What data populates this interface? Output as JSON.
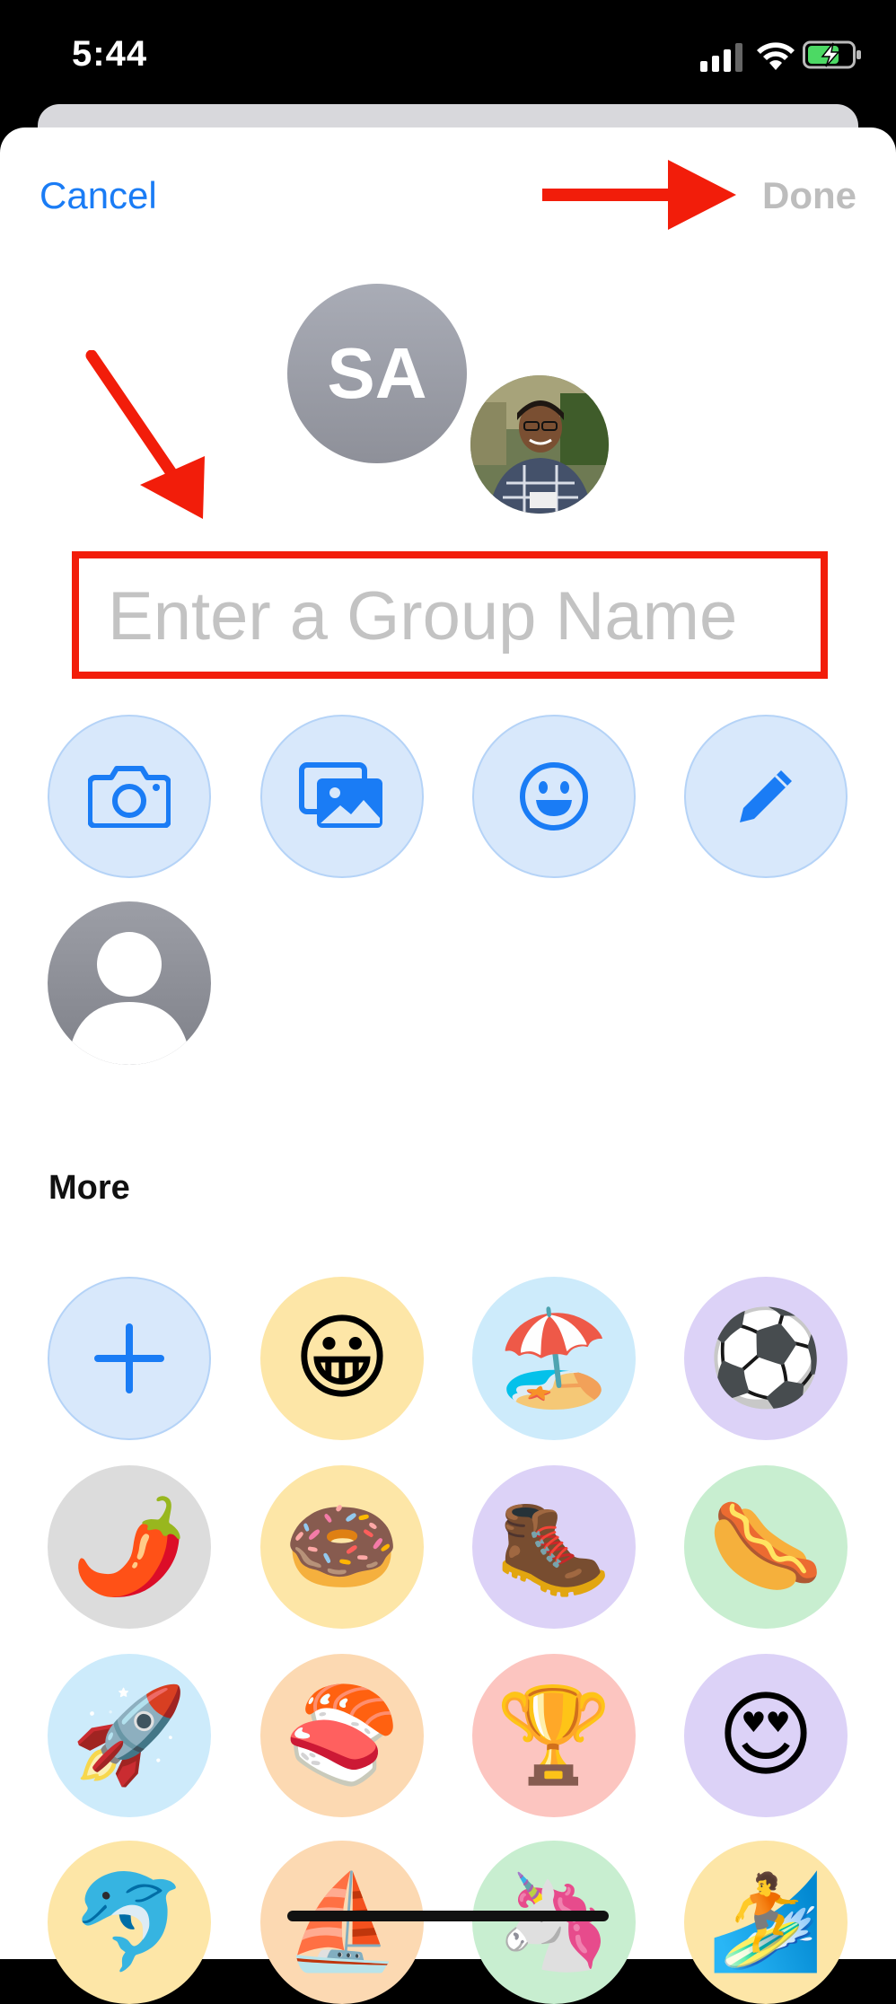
{
  "status_bar": {
    "time": "5:44"
  },
  "header": {
    "cancel_label": "Cancel",
    "done_label": "Done"
  },
  "group": {
    "avatar_initials": "SA",
    "name_placeholder": "Enter a Group Name"
  },
  "photo_options": [
    "camera-icon",
    "photos-icon",
    "emoji-icon",
    "pencil-icon"
  ],
  "more": {
    "title": "More",
    "items": [
      {
        "icon": "add-icon"
      },
      {
        "emoji": "😀",
        "bg": "#fde6a7"
      },
      {
        "emoji": "🏖️",
        "bg": "#cdebfb"
      },
      {
        "emoji": "⚽",
        "bg": "#dcd2f7"
      },
      {
        "emoji": "🌶️",
        "bg": "#dcdcdc"
      },
      {
        "emoji": "🍩",
        "bg": "#fde6a7"
      },
      {
        "emoji": "🥾",
        "bg": "#dcd2f7"
      },
      {
        "emoji": "🌭",
        "bg": "#c8eed0"
      },
      {
        "emoji": "🚀",
        "bg": "#cdebfb"
      },
      {
        "emoji": "🍣",
        "bg": "#fcd9b2"
      },
      {
        "emoji": "🏆",
        "bg": "#fcc5c0"
      },
      {
        "emoji": "😍",
        "bg": "#dcd2f7"
      },
      {
        "emoji": "🐬",
        "bg": "#fde6a7"
      },
      {
        "emoji": "⛵",
        "bg": "#fcd9b2"
      },
      {
        "emoji": "🦄",
        "bg": "#c8eed0"
      },
      {
        "emoji": "🏄",
        "bg": "#fde6a7"
      }
    ]
  },
  "colors": {
    "accent": "#1a7cf5",
    "annotation": "#f21d0a",
    "done_disabled": "#bdbdbd"
  }
}
